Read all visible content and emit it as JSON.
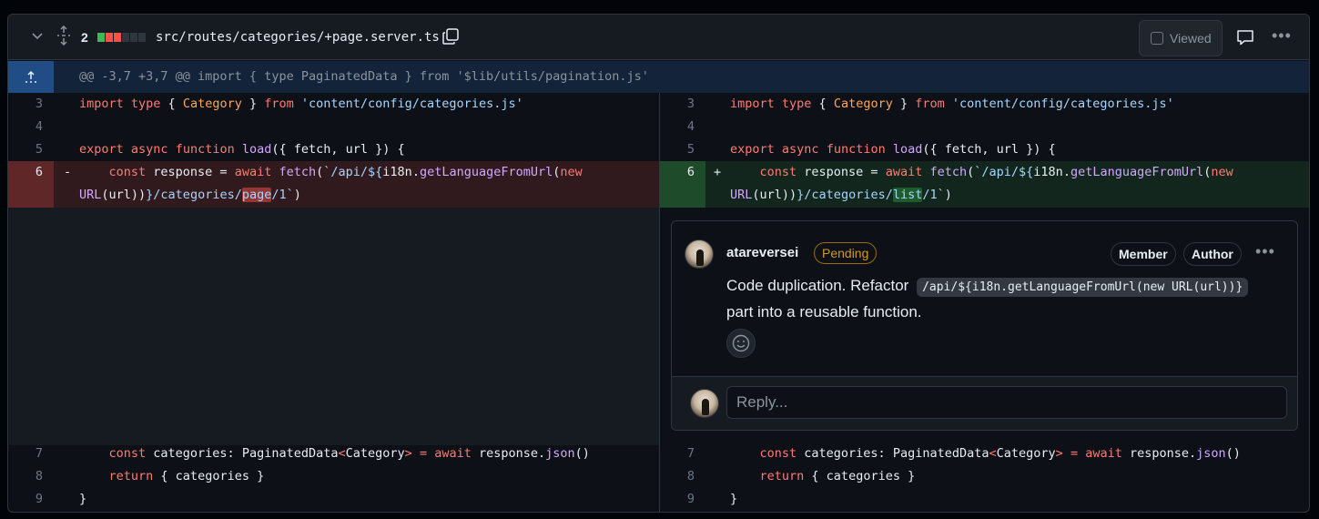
{
  "file": {
    "change_count": "2",
    "diffstat_colors": [
      "#3fb950",
      "#f85149",
      "#f85149",
      "#30363d",
      "#30363d",
      "#30363d"
    ],
    "path": "src/routes/categories/+page.server.ts",
    "viewed_label": "Viewed",
    "icons": [
      "chevron-down-icon",
      "unfold-icon",
      "copy-icon",
      "comment-icon",
      "kebab-icon",
      "expand-up-icon"
    ]
  },
  "hunk": {
    "header": "@@ -3,7 +3,7 @@ import { type PaginatedData } from '$lib/utils/pagination.js'"
  },
  "left": {
    "line_numbers": [
      "3",
      "4",
      "5",
      "6",
      "7",
      "8",
      "9"
    ],
    "deleted_sign": "-"
  },
  "right": {
    "line_numbers": [
      "3",
      "4",
      "5",
      "6",
      "7",
      "8",
      "9"
    ],
    "added_sign": "+"
  },
  "code": {
    "l3": {
      "kw1": "import",
      "kw2": " type",
      "p1": " { ",
      "type": "Category",
      "p2": " } ",
      "kw3": "from",
      "str": " 'content/config/categories.js'"
    },
    "l5": {
      "kw1": "export",
      "kw2": " async",
      "kw3": " function",
      "fn": " load",
      "rest": "({ fetch, url }) {"
    },
    "l6a": {
      "indent": "    ",
      "kw1": "const",
      "mid": " response = ",
      "kw2": "await",
      "fn": " fetch",
      "p": "(",
      "str1": "`/api/${",
      "var": "i18n",
      "dot": ".",
      "fn2": "getLanguageFromUrl",
      "p2": "(",
      "kw3": "new"
    },
    "l6b_left": {
      "rest1": "URL",
      "rest2": "(url))",
      "str1": "}/categories/",
      "hl": "page",
      "str2": "/1`",
      "close": ")"
    },
    "l6b_right": {
      "rest1": "URL",
      "rest2": "(url))",
      "str1": "}/categories/",
      "hl": "list",
      "str2": "/1`",
      "close": ")"
    },
    "l7": {
      "indent": "    ",
      "kw1": "const",
      "mid": " categories: ",
      "type1": "PaginatedData",
      "lt": "<",
      "type2": "Category",
      "gt": ">",
      "eq": " = ",
      "kw2": "await",
      "mid2": " response.",
      "fn": "json",
      "close": "()"
    },
    "l8": {
      "indent": "    ",
      "kw1": "return",
      "rest": " { categories }"
    },
    "l9": {
      "rest": "}"
    }
  },
  "comment": {
    "author": "atareversei",
    "status": "Pending",
    "badges": [
      "Member",
      "Author"
    ],
    "body_prefix": "Code duplication. Refactor",
    "inline_code": "/api/${i18n.getLanguageFromUrl(new URL(url))}",
    "body_suffix": "part into a reusable function.",
    "reply_placeholder": "Reply..."
  }
}
